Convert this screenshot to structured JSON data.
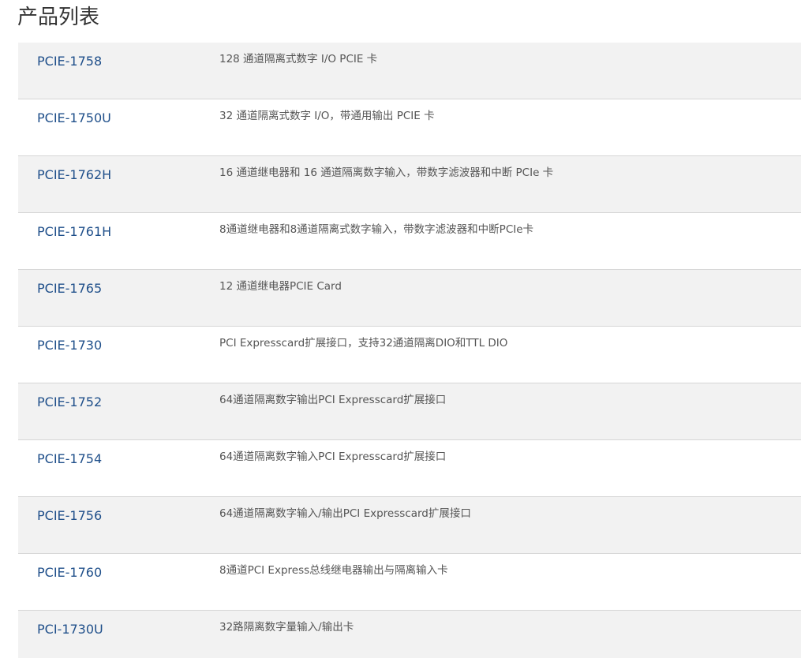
{
  "page": {
    "title": "产品列表"
  },
  "products": [
    {
      "model": "PCIE-1758",
      "description": "128 通道隔离式数字 I/O PCIE 卡"
    },
    {
      "model": "PCIE-1750U",
      "description": "32 通道隔离式数字 I/O，带通用输出 PCIE 卡"
    },
    {
      "model": "PCIE-1762H",
      "description": "16 通道继电器和 16 通道隔离数字输入，带数字滤波器和中断 PCIe 卡"
    },
    {
      "model": "PCIE-1761H",
      "description": "8通道继电器和8通道隔离式数字输入，带数字滤波器和中断PCIe卡"
    },
    {
      "model": "PCIE-1765",
      "description": "12 通道继电器PCIE Card"
    },
    {
      "model": "PCIE-1730",
      "description": "PCI Expresscard扩展接口，支持32通道隔离DIO和TTL DIO"
    },
    {
      "model": "PCIE-1752",
      "description": "64通道隔离数字输出PCI Expresscard扩展接口"
    },
    {
      "model": "PCIE-1754",
      "description": "64通道隔离数字输入PCI Expresscard扩展接口"
    },
    {
      "model": "PCIE-1756",
      "description": "64通道隔离数字输入/输出PCI Expresscard扩展接口"
    },
    {
      "model": "PCIE-1760",
      "description": "8通道PCI Express总线继电器输出与隔离输入卡"
    },
    {
      "model": "PCI-1730U",
      "description": "32路隔离数字量输入/输出卡"
    }
  ],
  "colors": {
    "link": "#1f4f8a",
    "row_alt": "#f2f2f2",
    "divider": "#d6d6d6"
  }
}
